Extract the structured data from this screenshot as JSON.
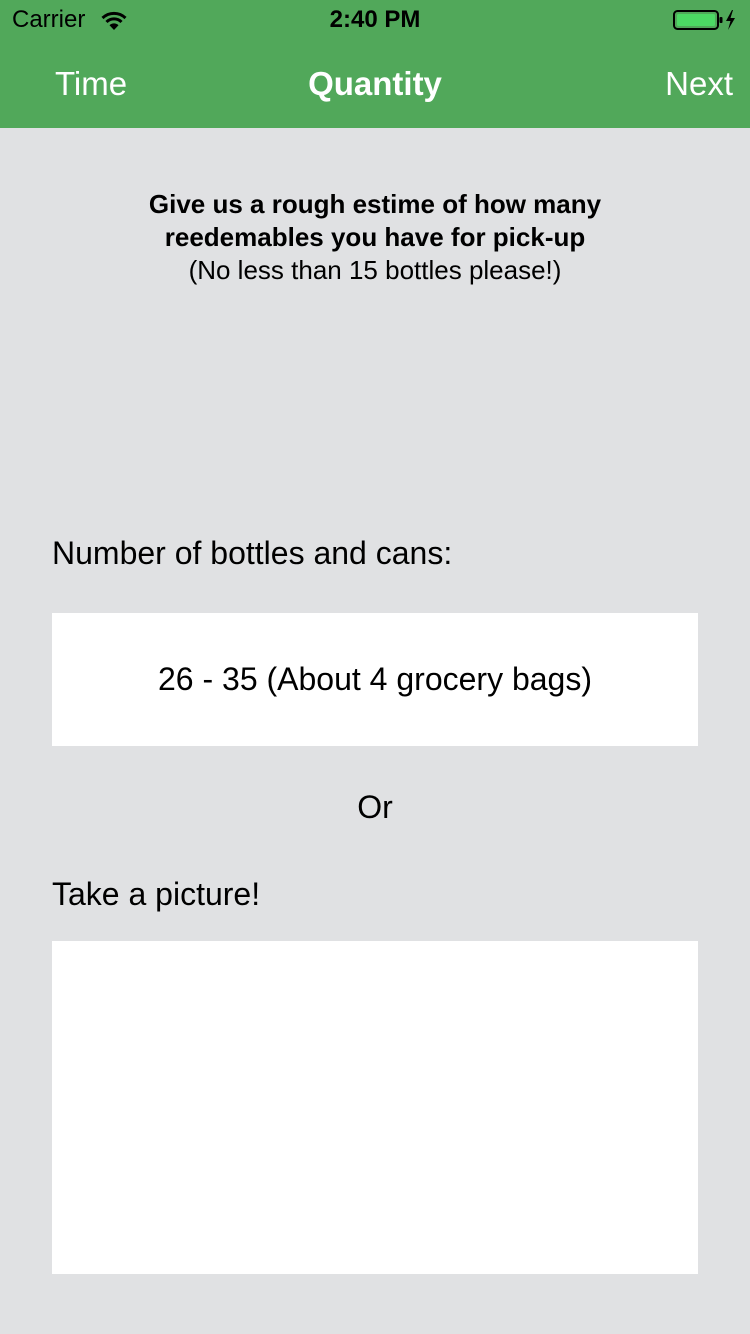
{
  "status_bar": {
    "carrier": "Carrier",
    "time": "2:40 PM",
    "wifi_icon": "wifi-icon",
    "battery_icon": "battery-charging-icon"
  },
  "nav": {
    "back_label": "Time",
    "title": "Quantity",
    "next_label": "Next",
    "color": "#51a85a"
  },
  "intro": {
    "line1": "Give us a rough estime of how many",
    "line2": "reedemables you have for pick-up",
    "note": "(No less than 15 bottles please!)"
  },
  "quantity": {
    "label": "Number of bottles and cans:",
    "selected_value": "26 - 35 (About 4 grocery bags)"
  },
  "or_label": "Or",
  "photo": {
    "label": "Take a picture!"
  },
  "colors": {
    "background": "#e0e1e3",
    "battery_fill": "#4cd964"
  }
}
